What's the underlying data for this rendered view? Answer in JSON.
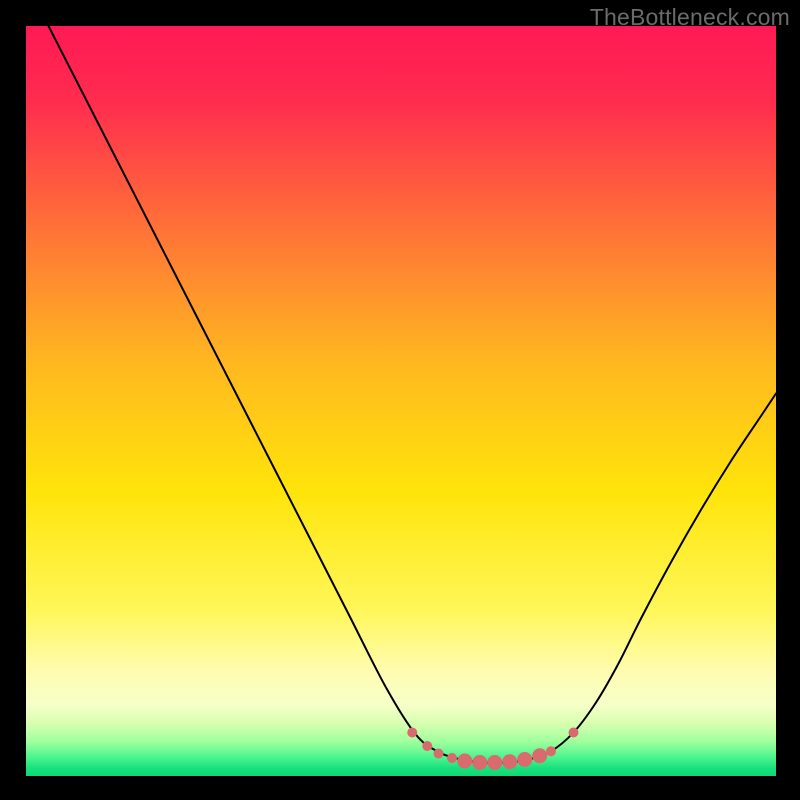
{
  "watermark": "TheBottleneck.com",
  "chart_data": {
    "type": "line",
    "title": "",
    "xlabel": "",
    "ylabel": "",
    "xlim": [
      0,
      100
    ],
    "ylim": [
      0,
      100
    ],
    "gradient_stops": [
      {
        "offset": 0.0,
        "color": "#ff1a55"
      },
      {
        "offset": 0.1,
        "color": "#ff2c4f"
      },
      {
        "offset": 0.25,
        "color": "#ff6a3a"
      },
      {
        "offset": 0.45,
        "color": "#ffb820"
      },
      {
        "offset": 0.62,
        "color": "#ffe40a"
      },
      {
        "offset": 0.78,
        "color": "#fff75a"
      },
      {
        "offset": 0.86,
        "color": "#fffcb0"
      },
      {
        "offset": 0.905,
        "color": "#f6ffc8"
      },
      {
        "offset": 0.93,
        "color": "#d7ffb0"
      },
      {
        "offset": 0.955,
        "color": "#9cff9c"
      },
      {
        "offset": 0.975,
        "color": "#4cf58e"
      },
      {
        "offset": 0.99,
        "color": "#17e07c"
      },
      {
        "offset": 1.0,
        "color": "#0fd877"
      }
    ],
    "series": [
      {
        "name": "bottleneck-curve",
        "x": [
          3,
          8,
          13,
          18,
          23,
          28,
          33,
          38,
          43,
          48,
          52,
          55,
          58,
          61,
          64,
          67,
          70,
          73,
          76,
          79,
          82,
          86,
          90,
          94,
          98,
          100
        ],
        "y": [
          100,
          90.2,
          80.4,
          70.6,
          60.8,
          51.0,
          41.2,
          31.4,
          21.6,
          11.8,
          5.5,
          3.2,
          2.2,
          1.8,
          1.8,
          2.2,
          3.3,
          5.8,
          9.8,
          15.0,
          21.0,
          28.5,
          35.5,
          42.0,
          48.0,
          51.0
        ]
      }
    ],
    "basin_markers": {
      "color": "#d96a6e",
      "radius_small": 5,
      "radius_large": 7.5,
      "points": [
        {
          "x": 51.5,
          "y": 5.8,
          "r": "small"
        },
        {
          "x": 53.5,
          "y": 4.0,
          "r": "small"
        },
        {
          "x": 55.0,
          "y": 3.0,
          "r": "small"
        },
        {
          "x": 56.8,
          "y": 2.4,
          "r": "small"
        },
        {
          "x": 58.5,
          "y": 2.0,
          "r": "large"
        },
        {
          "x": 60.5,
          "y": 1.8,
          "r": "large"
        },
        {
          "x": 62.5,
          "y": 1.8,
          "r": "large"
        },
        {
          "x": 64.5,
          "y": 1.9,
          "r": "large"
        },
        {
          "x": 66.5,
          "y": 2.2,
          "r": "large"
        },
        {
          "x": 68.5,
          "y": 2.7,
          "r": "large"
        },
        {
          "x": 70.0,
          "y": 3.3,
          "r": "small"
        },
        {
          "x": 73.0,
          "y": 5.8,
          "r": "small"
        }
      ]
    }
  }
}
